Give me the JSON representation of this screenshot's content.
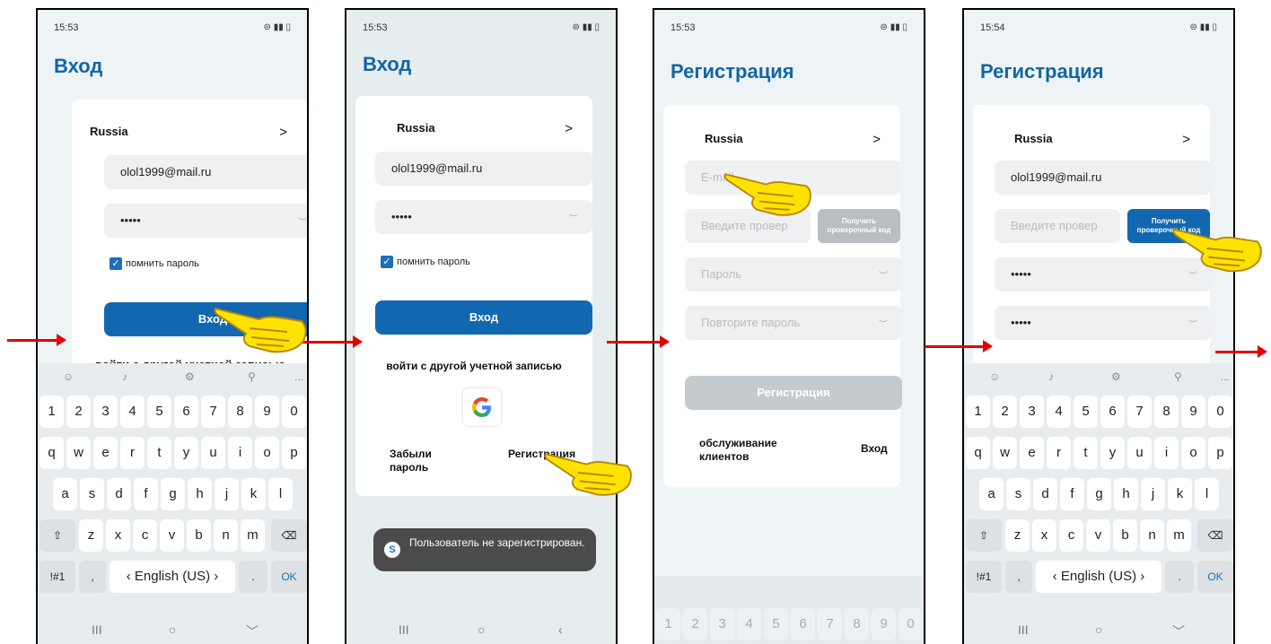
{
  "screens": [
    {
      "time": "15:53",
      "title": "Вход",
      "country": "Russia",
      "email": "olol1999@mail.ru",
      "password": "•••••",
      "remember": "помнить пароль",
      "login": "Вход",
      "other": "войти с другой учетной записью"
    },
    {
      "time": "15:53",
      "title": "Вход",
      "country": "Russia",
      "email": "olol1999@mail.ru",
      "password": "•••••",
      "remember": "помнить пароль",
      "login": "Вход",
      "other": "войти с другой учетной записью",
      "forgot": "Забыли пароль",
      "register": "Регистрация",
      "toast": "Пользователь не зарегистрирован."
    },
    {
      "time": "15:53",
      "title": "Регистрация",
      "country": "Russia",
      "email_ph": "E-mail",
      "code_ph": "Введите провер",
      "code_btn": "Получить проверочный код",
      "pass_ph": "Пароль",
      "repeat_ph": "Повторите пароль",
      "register": "Регистрация",
      "support": "обслуживание клиентов",
      "login": "Вход"
    },
    {
      "time": "15:54",
      "title": "Регистрация",
      "country": "Russia",
      "email": "olol1999@mail.ru",
      "code_ph": "Введите провер",
      "code_btn": "Получить проверочный код",
      "password": "•••••",
      "repeat": "•••••"
    }
  ],
  "keyboard": {
    "digits": [
      "1",
      "2",
      "3",
      "4",
      "5",
      "6",
      "7",
      "8",
      "9",
      "0"
    ],
    "row1": [
      "q",
      "w",
      "e",
      "r",
      "t",
      "y",
      "u",
      "i",
      "o",
      "p"
    ],
    "row2": [
      "a",
      "s",
      "d",
      "f",
      "g",
      "h",
      "j",
      "k",
      "l"
    ],
    "row3": [
      "z",
      "x",
      "c",
      "v",
      "b",
      "n",
      "m"
    ],
    "sym": "!#1",
    "comma": ",",
    "lang": "English (US)",
    "dot": ".",
    "ok": "OK",
    "more": "..."
  },
  "glyphs": {
    "chev": ">",
    "check": "✓",
    "shift": "⇧",
    "back": "⌫",
    "left": "‹",
    "right": "›",
    "eye": "︶",
    "nav": [
      "III",
      "○",
      "﹀"
    ]
  },
  "colors": {
    "accent": "#1268b0",
    "arrow": "#e40000",
    "bg": "#eef4f6"
  }
}
